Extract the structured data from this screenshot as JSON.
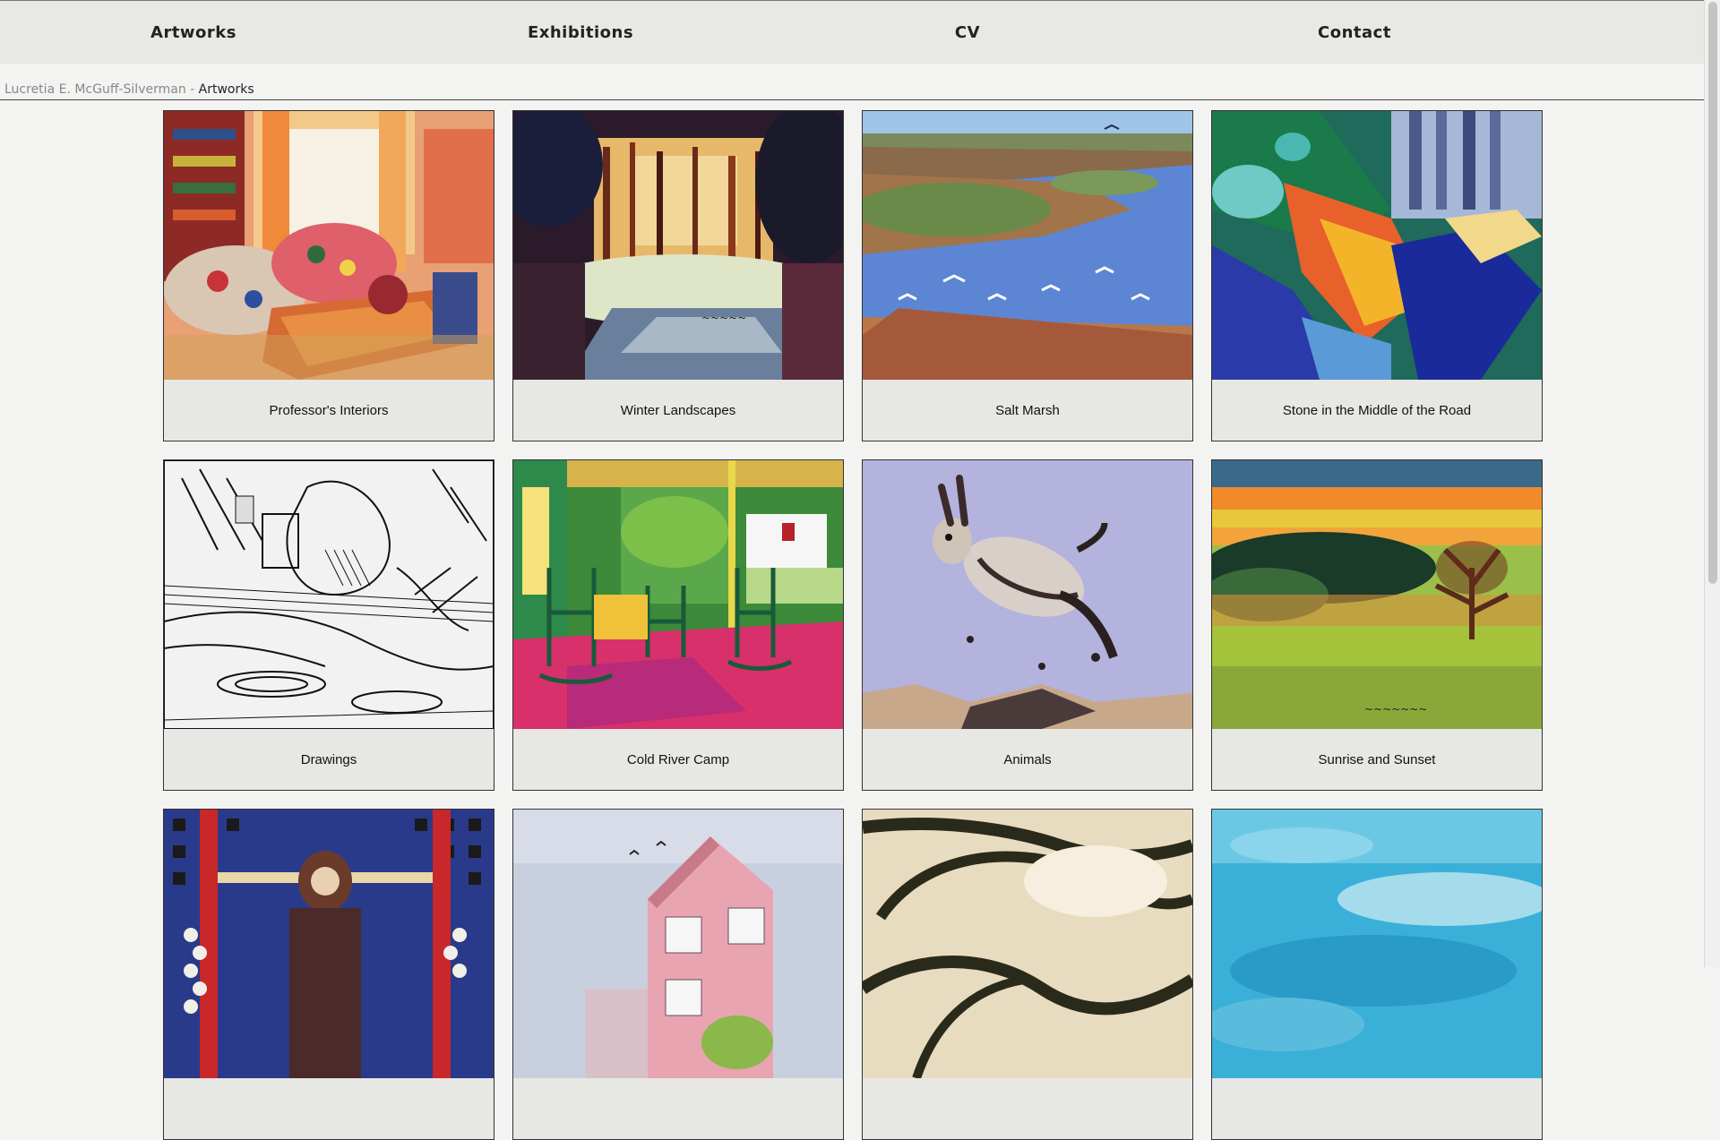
{
  "nav": {
    "items": [
      "Artworks",
      "Exhibitions",
      "CV",
      "Contact"
    ]
  },
  "breadcrumb": {
    "parent": "Lucretia E. McGuff-Silverman",
    "separator": " - ",
    "current": "Artworks"
  },
  "gallery": {
    "items": [
      {
        "title": "Professor's Interiors",
        "icon": "interior-painting"
      },
      {
        "title": "Winter Landscapes",
        "icon": "winter-landscape-painting"
      },
      {
        "title": "Salt Marsh",
        "icon": "salt-marsh-painting"
      },
      {
        "title": "Stone in the Middle of the Road",
        "icon": "abstract-road-painting"
      },
      {
        "title": "Drawings",
        "icon": "ink-drawing"
      },
      {
        "title": "Cold River Camp",
        "icon": "porch-rocking-chairs-painting"
      },
      {
        "title": "Animals",
        "icon": "rabbit-painting"
      },
      {
        "title": "Sunrise and Sunset",
        "icon": "sunset-landscape-painting"
      },
      {
        "title": "",
        "icon": "figure-painting"
      },
      {
        "title": "",
        "icon": "house-sketch"
      },
      {
        "title": "",
        "icon": "abstract-brush-drawing"
      },
      {
        "title": "",
        "icon": "blue-abstract-painting"
      }
    ]
  },
  "colors": {
    "nav_bg": "#e8e8e4",
    "page_bg": "#f3f3f2",
    "card_bg": "#e7e7e3"
  }
}
